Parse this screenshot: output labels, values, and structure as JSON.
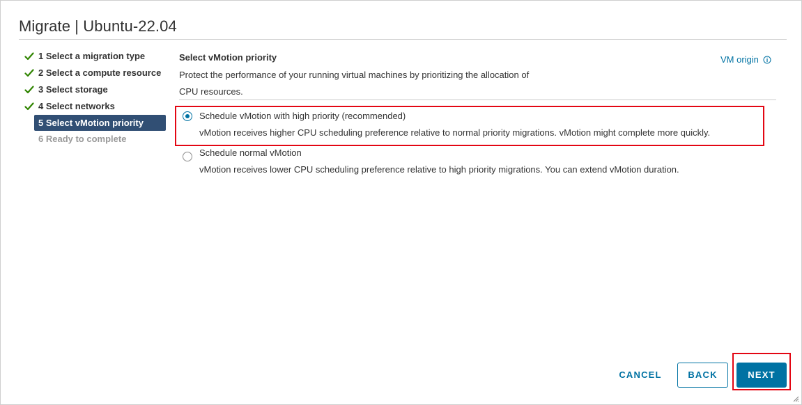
{
  "dialog": {
    "title": "Migrate | Ubuntu-22.04"
  },
  "steps": [
    {
      "label": "1 Select a migration type",
      "state": "completed"
    },
    {
      "label": "2 Select a compute resource",
      "state": "completed"
    },
    {
      "label": "3 Select storage",
      "state": "completed"
    },
    {
      "label": "4 Select networks",
      "state": "completed"
    },
    {
      "label": "5 Select vMotion priority",
      "state": "current"
    },
    {
      "label": "6 Ready to complete",
      "state": "pending"
    }
  ],
  "content": {
    "section_title": "Select vMotion priority",
    "description_line1": "Protect the performance of your running virtual machines by prioritizing the allocation of",
    "description_line2": "CPU resources.",
    "origin_link": "VM origin",
    "options": [
      {
        "label": "Schedule vMotion with high priority (recommended)",
        "description": "vMotion receives higher CPU scheduling preference relative to normal priority migrations. vMotion might complete more quickly.",
        "selected": true
      },
      {
        "label": "Schedule normal vMotion",
        "description": "vMotion receives lower CPU scheduling preference relative to high priority migrations. You can extend vMotion duration.",
        "selected": false
      }
    ]
  },
  "footer": {
    "cancel_label": "CANCEL",
    "back_label": "BACK",
    "next_label": "NEXT"
  },
  "icons": {
    "step_check": "check-icon",
    "origin_info": "info-circle-icon",
    "resize": "resize-grip-icon"
  },
  "colors": {
    "accent": "#0072a3",
    "current_step_bg": "#314f74",
    "check_green": "#2f8400",
    "highlight_red": "#e30613"
  }
}
